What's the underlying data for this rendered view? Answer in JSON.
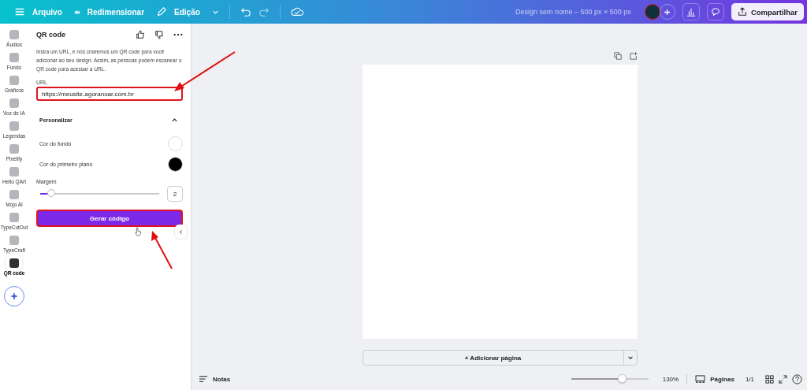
{
  "topbar": {
    "menu": [
      "Arquivo",
      "Redimensionar",
      "Edição"
    ],
    "title": "Design sem nome – 500 px × 500 px",
    "share": "Compartilhar"
  },
  "rail": [
    {
      "label": "Áudios",
      "selected": false
    },
    {
      "label": "Fundo",
      "selected": false
    },
    {
      "label": "Gráficos",
      "selected": false
    },
    {
      "label": "Voz de IA",
      "selected": false
    },
    {
      "label": "Legendas",
      "selected": false
    },
    {
      "label": "Pixelify",
      "selected": false
    },
    {
      "label": "Hello QArt",
      "selected": false
    },
    {
      "label": "Mojo AI",
      "selected": false
    },
    {
      "label": "TypeCutOut",
      "selected": false
    },
    {
      "label": "TypeCraft",
      "selected": false
    },
    {
      "label": "QR code",
      "selected": true
    }
  ],
  "panel": {
    "title": "QR code",
    "description": "Insira um URL, e nós criaremos um QR code para você adicionar ao seu design. Assim, as pessoas podem escanear o QR code para acessar a URL.",
    "url_label": "URL",
    "url_value": "https://meusite.agoranoar.com.br",
    "section": {
      "title": "Personalizar",
      "expanded": true
    },
    "colors": [
      {
        "label": "Cor do fundo",
        "color": "#ffffff"
      },
      {
        "label": "Cor do primeiro plano",
        "color": "#000000"
      }
    ],
    "margin": {
      "label": "Margem",
      "level": 0.1,
      "value": "2"
    },
    "button": "Gerar código"
  },
  "add_page": "+ Adicionar página",
  "footer": {
    "notes": "Notas",
    "zoom": {
      "level": 0.67,
      "reading": "130%"
    },
    "pages": "Páginas",
    "page_count": "1/1"
  }
}
